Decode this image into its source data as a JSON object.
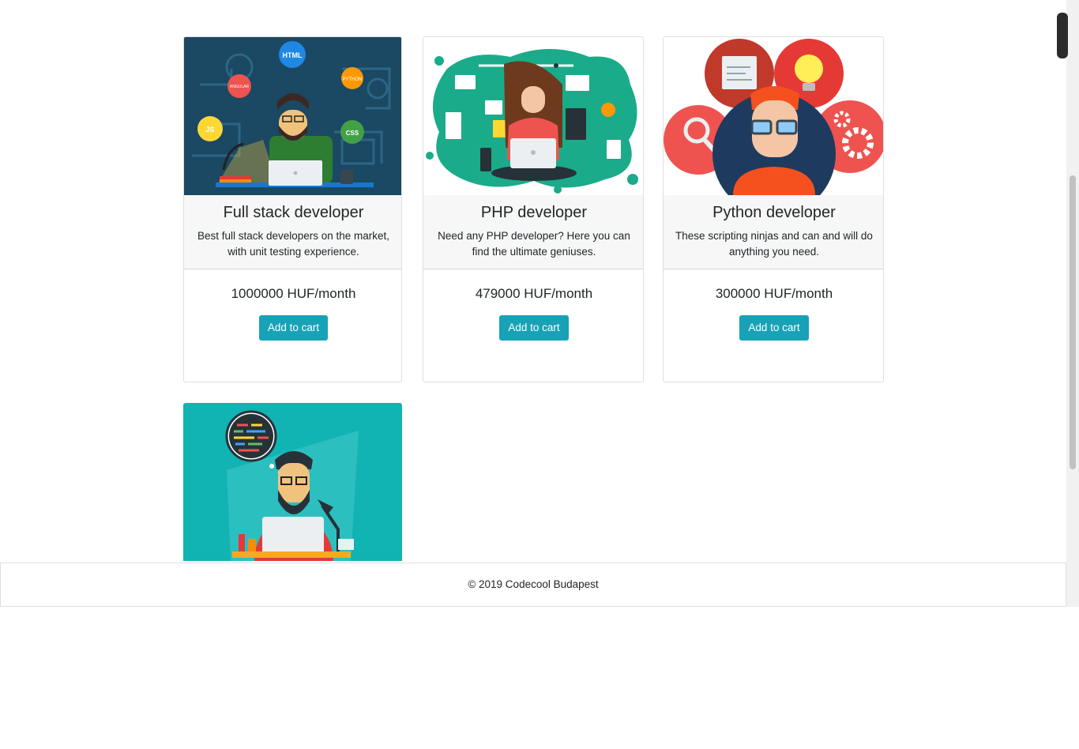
{
  "products": [
    {
      "title": "Full stack developer",
      "description": "Best full stack developers on the market, with unit testing experience.",
      "price": "1000000 HUF/month",
      "button_label": "Add to cart",
      "image_labels": [
        "HTML",
        "ANGULAR",
        "PYTHON",
        "JS",
        "CSS"
      ]
    },
    {
      "title": "PHP developer",
      "description": "Need any PHP developer? Here you can find the ultimate geniuses.",
      "price": "479000 HUF/month",
      "button_label": "Add to cart"
    },
    {
      "title": "Python developer",
      "description": "These scripting ninjas and can and will do anything you need.",
      "price": "300000 HUF/month",
      "button_label": "Add to cart"
    }
  ],
  "footer": {
    "text": "© 2019 Codecool Budapest"
  },
  "colors": {
    "button": "#17a2b8",
    "card_header": "#f7f7f7"
  }
}
